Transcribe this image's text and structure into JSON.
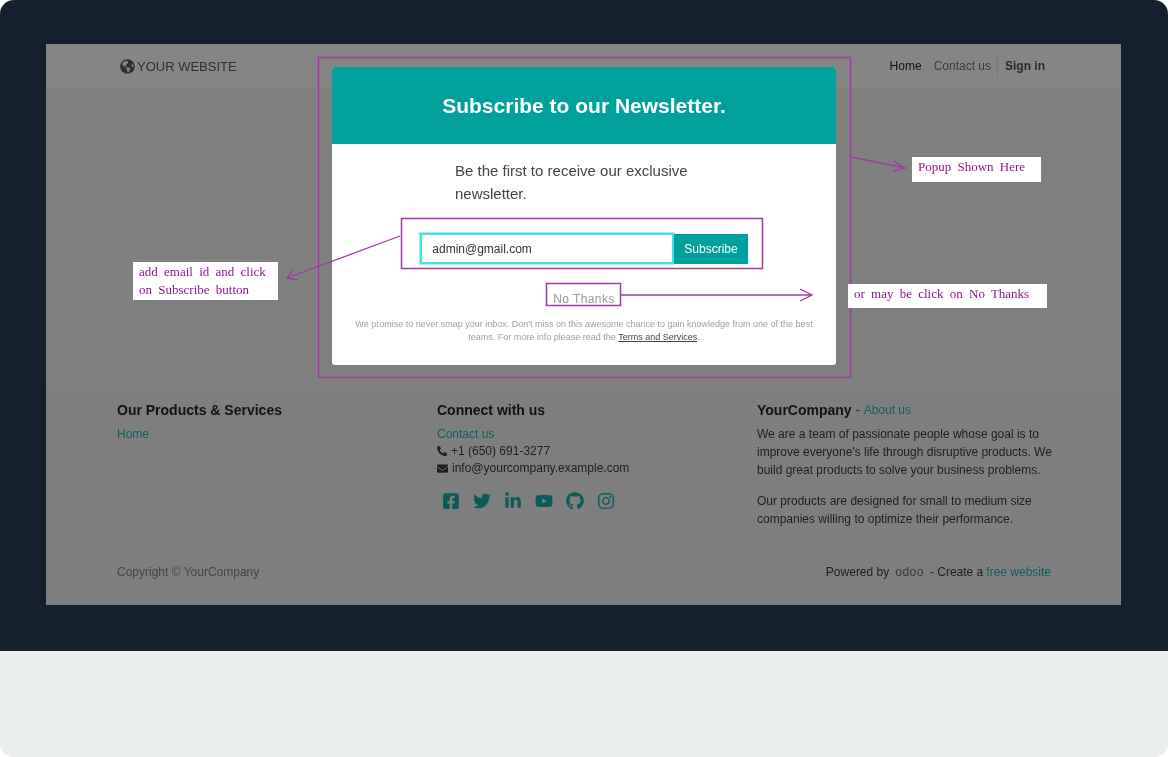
{
  "header": {
    "logo": "YOUR WEBSITE",
    "nav": [
      {
        "label": "Home",
        "selected": true
      },
      {
        "label": "Contact us",
        "selected": false
      }
    ],
    "sign_in": "Sign in"
  },
  "popup": {
    "title": "Subscribe to our Newsletter.",
    "description": "Be the first to receive our exclusive newsletter.",
    "email": {
      "value": "admin@gmail.com"
    },
    "subscribe_button": "Subscribe",
    "no_thanks": "No Thanks",
    "footnote": "We promise to never smap your inbox. Don't miss on this awesome chance to gain knowledge from one of the best teams. For more info please read the ",
    "footnote_link": "Terms and Services",
    "footnote_end": "."
  },
  "footer": {
    "products": {
      "heading": "Our Products & Services",
      "links": [
        "Home"
      ]
    },
    "connect": {
      "heading": "Connect with us",
      "link": "Contact us",
      "phone": "+1 (650) 691-3277",
      "email": "info@yourcompany.example.com"
    },
    "company": {
      "heading": "YourCompany",
      "separator": "-",
      "about_link": "About us",
      "paragraphs": [
        "We are a team of passionate people whose goal is to improve everyone's life through disruptive products. We build great products to solve your business problems.",
        "Our products are designed for small to medium size companies willing to optimize their performance."
      ]
    },
    "copyright": "Copyright © YourCompany",
    "powered_by": "Powered by",
    "powered_logo": "odoo",
    "create_text": "- Create a",
    "create_link": "free website"
  },
  "annotations": [
    {
      "kind": "right",
      "text": "Popup Shown Here"
    },
    {
      "kind": "left",
      "text": "add email id and click on Subscribe button"
    },
    {
      "kind": "bottom",
      "text": "or may be click on No Thanks"
    }
  ]
}
